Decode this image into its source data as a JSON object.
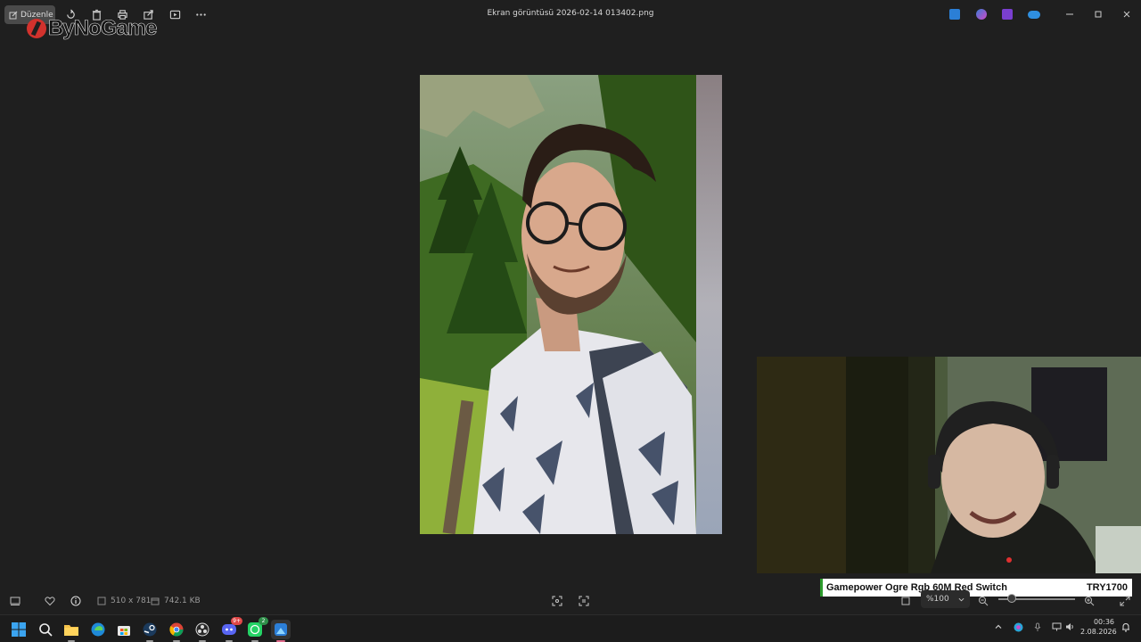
{
  "window": {
    "title": "Ekran görüntüsü 2026-02-14 013402.png",
    "edit_label": "Düzenle"
  },
  "watermark": {
    "text": "ByNoGame"
  },
  "toolbar_icons": [
    "rotate-icon",
    "delete-icon",
    "print-icon",
    "share-icon",
    "slideshow-icon",
    "more-icon"
  ],
  "status": {
    "dimensions": "510 x 781",
    "file_size": "742.1 KB",
    "zoom": "%100"
  },
  "overlay": {
    "product_name": "Gamepower Ogre Rgb 60M Red Switch",
    "price": "TRY1700"
  },
  "taskbar": {
    "time": "00:36",
    "date": "2.08.2026",
    "apps": [
      "start",
      "search",
      "file-explorer",
      "edge",
      "store",
      "steam",
      "chrome",
      "obs",
      "discord",
      "whatsapp",
      "photos"
    ],
    "discord_badge": "9+",
    "whatsapp_badge": "2"
  },
  "colors": {
    "accent": "#e06a8a",
    "background": "#1f1f1f",
    "product_border": "#2d9c2d"
  }
}
